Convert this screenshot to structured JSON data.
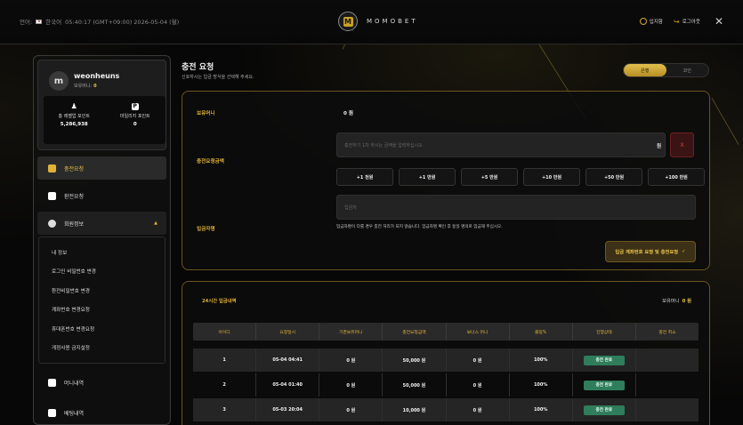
{
  "topbar": {
    "lang_label": "언어:",
    "lang_value": "한국어",
    "datetime": "05:40:17 (GMT+09:00) 2026-05-04 (월)",
    "logo_letter": "M",
    "logo_text": "MOMOBET",
    "deposit_label": "입지함",
    "logout_label": "로그아웃",
    "close_symbol": "✕"
  },
  "user": {
    "avatar_letter": "m",
    "name": "weonheuns",
    "balance_label": "보유머니:",
    "balance": "0",
    "points": [
      {
        "label": "총 레벨업 포인트",
        "value": "5,286,938",
        "icon": "person-icon"
      },
      {
        "label": "마일리지 포인트",
        "value": "0",
        "icon": "p-badge-icon"
      }
    ]
  },
  "menu": {
    "items": [
      {
        "label": "충전요청",
        "active": true
      },
      {
        "label": "환전요청"
      },
      {
        "label": "회원정보",
        "caret": "▲"
      }
    ],
    "submenu": [
      "내 정보",
      "로그인 비밀번호 변경",
      "환전비밀번호 변경",
      "계좌번호 변경요청",
      "휴대폰번호 변경요청",
      "게정사용 금지설정"
    ],
    "bottom": [
      "머니내역",
      "베팅내역"
    ]
  },
  "page": {
    "title": "충전 요청",
    "subtitle": "신호하시는 입금 방식을 선택해 주세요.",
    "toggle": [
      "은행",
      "코인"
    ]
  },
  "form": {
    "balance_label": "보유머니",
    "balance_value": "0 원",
    "amount_label": "충전요청금액",
    "amount_placeholder": "충전하기 1차 하시는 금액을 입력하십시오",
    "amount_unit": "원",
    "clear_symbol": "X",
    "quick_amounts": [
      "+1 천원",
      "+1 만원",
      "+5 만원",
      "+10 만원",
      "+50 만원",
      "+100 만원"
    ],
    "depositor_label": "입금자명",
    "depositor_placeholder": "입금자",
    "note": "입금자명이 다를 경우 충전 처리가 되지 않습니다. 입금자명 확인 후 동일 명의로 입금해 주십시오.",
    "request_button": "입금 계좌번호 요청 및 충전요청",
    "request_icon": "✓"
  },
  "history": {
    "title": "24시간 입금내역",
    "balance_label": "보유머니",
    "balance_value": "0 원",
    "columns": [
      "아이디",
      "요청일시",
      "기존보유머니",
      "충전요청금액",
      "보너스 머니",
      "롤링%",
      "진행상태",
      "충전 취소"
    ],
    "rows": [
      [
        "1",
        "05-04 04:41",
        "0 원",
        "50,000 원",
        "0 원",
        "100%",
        "충전 완료",
        ""
      ],
      [
        "2",
        "05-04 01:40",
        "0 원",
        "50,000 원",
        "0 원",
        "100%",
        "충전 완료",
        ""
      ],
      [
        "3",
        "05-03 20:04",
        "0 원",
        "10,000 원",
        "0 원",
        "100%",
        "충전 완료",
        ""
      ]
    ]
  },
  "colors": {
    "accent": "#e0b236",
    "status_green": "#2f7d5c"
  }
}
